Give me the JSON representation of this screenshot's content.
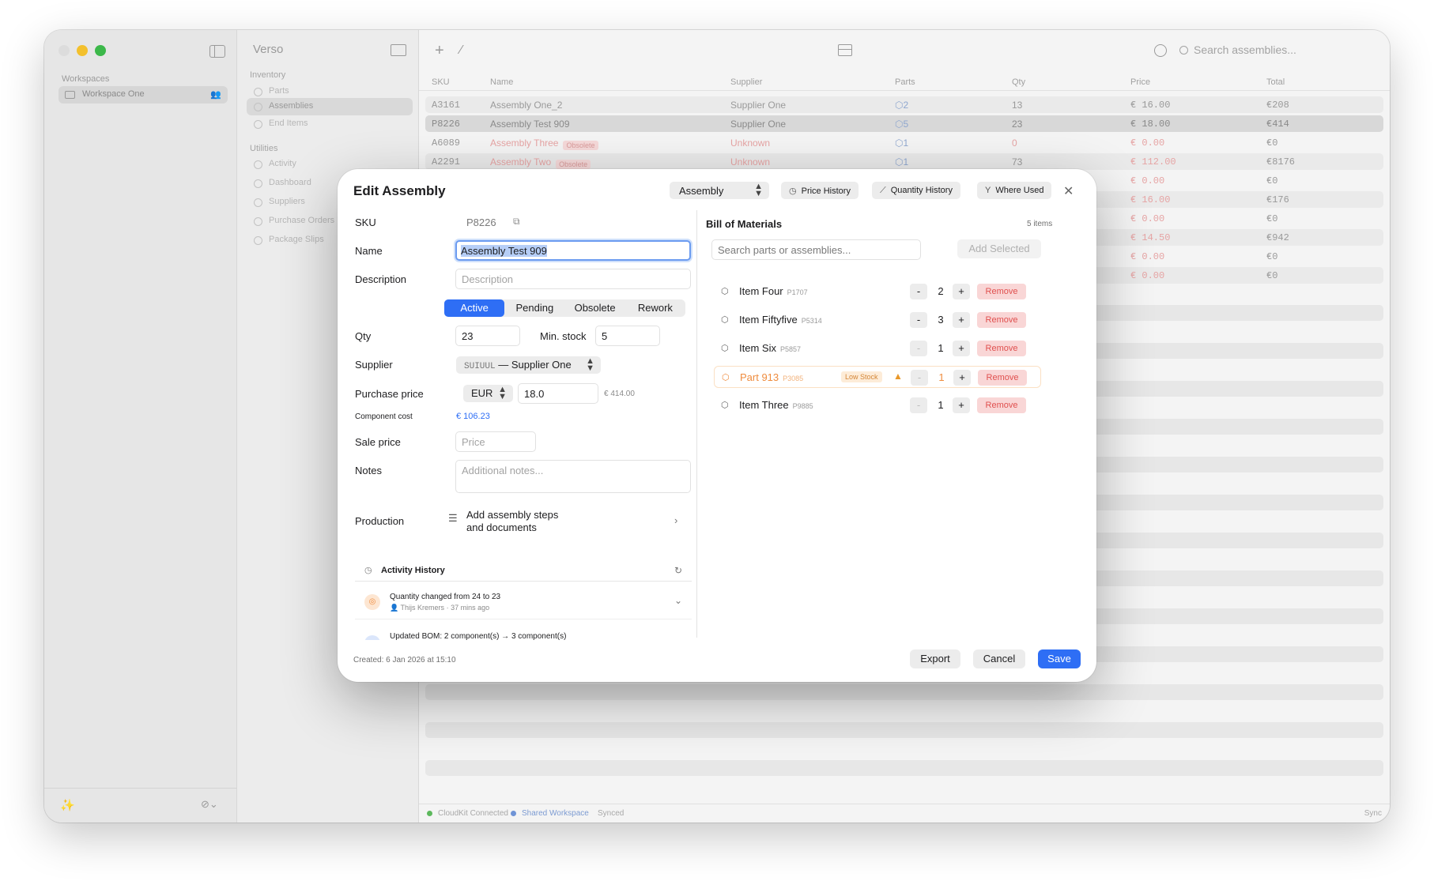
{
  "sidebar": {
    "workspaces_label": "Workspaces",
    "workspace_name": "Workspace One"
  },
  "list_pane": {
    "app_name": "Verso",
    "inventory_label": "Inventory",
    "inventory_items": [
      "Parts",
      "Assemblies",
      "End Items"
    ],
    "utilities_label": "Utilities",
    "utilities_items": [
      "Activity",
      "Dashboard",
      "Suppliers",
      "Purchase Orders",
      "Package Slips"
    ]
  },
  "toolbar": {
    "search_placeholder": "Search assemblies..."
  },
  "table": {
    "columns": [
      "SKU",
      "Name",
      "Supplier",
      "Parts",
      "Qty",
      "Price",
      "Total"
    ],
    "rows": [
      {
        "sku": "A3161",
        "name": "Assembly One_2",
        "badge": "",
        "supplier": "Supplier One",
        "parts": "2",
        "qty": "13",
        "price": "€ 16.00",
        "total": "€208",
        "obsolete": false
      },
      {
        "sku": "P8226",
        "name": "Assembly Test 909",
        "badge": "",
        "supplier": "Supplier One",
        "parts": "5",
        "qty": "23",
        "price": "€ 18.00",
        "total": "€414",
        "obsolete": false
      },
      {
        "sku": "A6089",
        "name": "Assembly Three",
        "badge": "Obsolete",
        "supplier": "Unknown",
        "parts": "1",
        "qty": "0",
        "price": "€ 0.00",
        "total": "€0",
        "obsolete": true
      },
      {
        "sku": "A2291",
        "name": "Assembly Two",
        "badge": "Obsolete",
        "supplier": "Unknown",
        "parts": "1",
        "qty": "73",
        "price": "€ 112.00",
        "total": "€8176",
        "obsolete": true
      }
    ],
    "hidden_rows_price_total": [
      {
        "price": "€ 0.00",
        "total": "€0"
      },
      {
        "price": "€ 16.00",
        "total": "€176"
      },
      {
        "price": "€ 0.00",
        "total": "€0"
      },
      {
        "price": "€ 14.50",
        "total": "€942"
      },
      {
        "price": "€ 0.00",
        "total": "€0"
      },
      {
        "price": "€ 0.00",
        "total": "€0"
      }
    ]
  },
  "status_bar": {
    "cloudkit": "CloudKit Connected",
    "shared": "Shared Workspace",
    "synced": "Synced",
    "sync_right": "Sync"
  },
  "modal": {
    "title": "Edit Assembly",
    "type_select": "Assembly",
    "price_history": "Price History",
    "quantity_history": "Quantity History",
    "where_used": "Where Used",
    "sku_label": "SKU",
    "sku_value": "P8226",
    "name_label": "Name",
    "name_value": "Assembly Test 909",
    "description_label": "Description",
    "description_placeholder": "Description",
    "status_options": [
      "Active",
      "Pending",
      "Obsolete",
      "Rework"
    ],
    "status_selected": "Active",
    "qty_label": "Qty",
    "qty_value": "23",
    "min_stock_label": "Min. stock",
    "min_stock_value": "5",
    "supplier_label": "Supplier",
    "supplier_code": "SUIUUL",
    "supplier_name": "— Supplier One",
    "purchase_price_label": "Purchase price",
    "currency": "EUR",
    "purchase_price_value": "18.0",
    "purchase_total": "€ 414.00",
    "component_cost_label": "Component cost",
    "component_cost_value": "€ 106.23",
    "sale_price_label": "Sale price",
    "sale_price_placeholder": "Price",
    "notes_label": "Notes",
    "notes_placeholder": "Additional notes...",
    "production_label": "Production",
    "production_line1": "Add assembly steps",
    "production_line2": "and documents",
    "activity_title": "Activity History",
    "activity1_text": "Quantity changed from 24 to 23",
    "activity1_user": "Thijs Kremers",
    "activity1_time": "37 mins ago",
    "activity2_text": "Updated BOM: 2 component(s) → 3 component(s)",
    "created": "Created: 6 Jan 2026 at 15:10",
    "export": "Export",
    "cancel": "Cancel",
    "save": "Save",
    "bom_title": "Bill of Materials",
    "bom_count": "5 items",
    "bom_search_placeholder": "Search parts or assemblies...",
    "add_selected": "Add Selected",
    "low_stock": "Low Stock",
    "remove": "Remove",
    "bom_items": [
      {
        "name": "Item Four",
        "sku": "P1707",
        "qty": "2",
        "low": false
      },
      {
        "name": "Item Fiftyfive",
        "sku": "P5314",
        "qty": "3",
        "low": false
      },
      {
        "name": "Item Six",
        "sku": "P5857",
        "qty": "1",
        "low": false
      },
      {
        "name": "Part 913",
        "sku": "P3085",
        "qty": "1",
        "low": true
      },
      {
        "name": "Item Three",
        "sku": "P9885",
        "qty": "1",
        "low": false
      }
    ]
  },
  "colors": {
    "accent": "#2e6ef5",
    "warning": "#ef8c3e",
    "danger": "#e0504f"
  }
}
